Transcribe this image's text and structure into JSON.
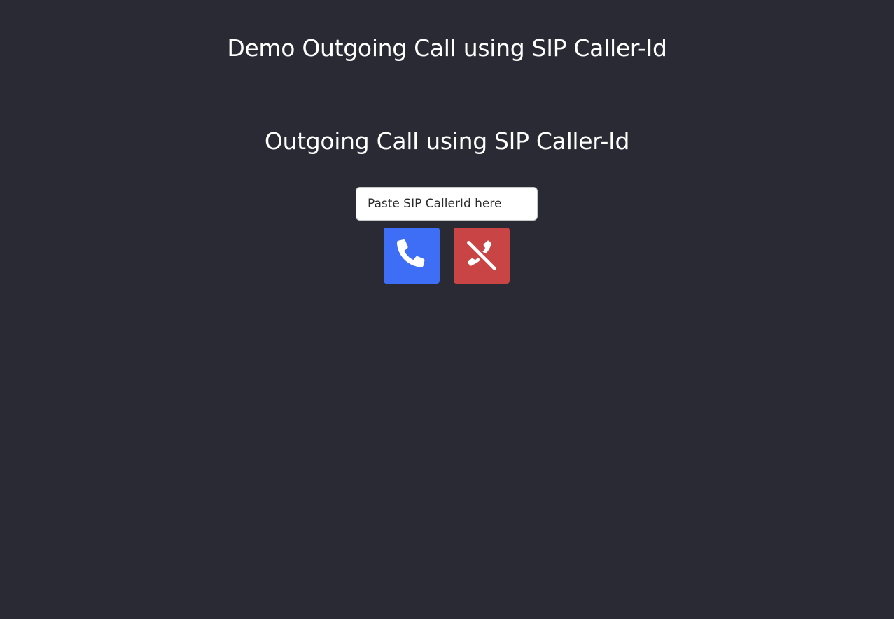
{
  "header": {
    "title": "Demo Outgoing Call using SIP Caller-Id"
  },
  "main": {
    "section_title": "Outgoing Call using SIP Caller-Id",
    "caller_input": {
      "value": "",
      "placeholder": "Paste SIP CallerId here"
    },
    "call_button": {
      "icon": "phone-icon",
      "color": "#3d6ef5"
    },
    "hangup_button": {
      "icon": "phone-slash-icon",
      "color": "#c94545"
    }
  },
  "colors": {
    "background": "#292a33",
    "text": "#ffffff"
  }
}
